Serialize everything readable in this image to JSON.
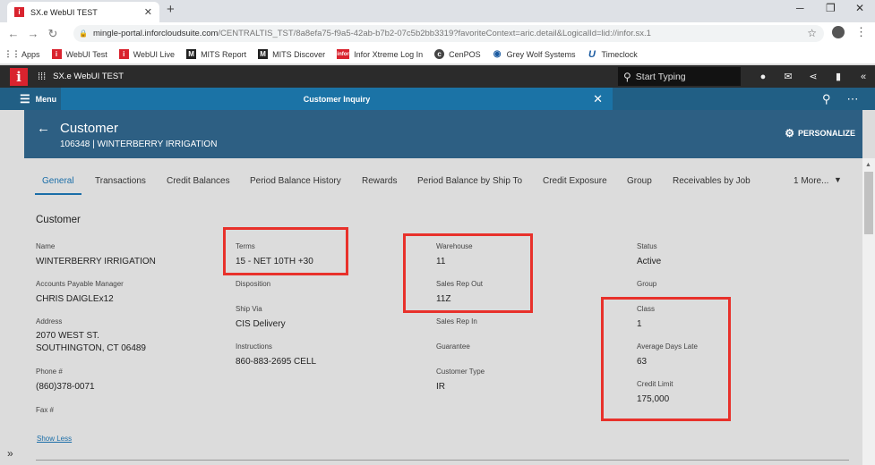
{
  "browser": {
    "tab_title": "SX.e WebUI TEST",
    "tab_favicon": "i",
    "new_tab": "+",
    "url_main": "mingle-portal.inforcloudsuite.com",
    "url_rest": "/CENTRALTIS_TST/8a8efa75-f9a5-42ab-b7b2-07c5b2bb3319?favoriteContext=aric.detail&LogicalId=lid://infor.sx.1",
    "bookmarks": [
      {
        "label": "Apps",
        "icon": "apps-grid-icon"
      },
      {
        "label": "WebUI Test",
        "icon": "infor-icon"
      },
      {
        "label": "WebUI Live",
        "icon": "infor-icon"
      },
      {
        "label": "MITS Report",
        "icon": "mits-icon"
      },
      {
        "label": "MITS Discover",
        "icon": "mits-icon"
      },
      {
        "label": "Infor Xtreme Log In",
        "icon": "infor-xtreme-icon"
      },
      {
        "label": "CenPOS",
        "icon": "cenpos-icon"
      },
      {
        "label": "Grey Wolf Systems",
        "icon": "greywolf-icon"
      },
      {
        "label": "Timeclock",
        "icon": "timeclock-icon"
      }
    ]
  },
  "appbar": {
    "title": "SX.e WebUI TEST",
    "search_placeholder": "Start Typing"
  },
  "navbar": {
    "menu_label": "Menu",
    "active_tab": "Customer Inquiry"
  },
  "header": {
    "title": "Customer",
    "subtitle": "106348 | WINTERBERRY IRRIGATION",
    "personalize": "PERSONALIZE"
  },
  "tabs": [
    "General",
    "Transactions",
    "Credit Balances",
    "Period Balance History",
    "Rewards",
    "Period Balance by Ship To",
    "Credit Exposure",
    "Group",
    "Receivables by Job",
    "1 More..."
  ],
  "section_title": "Customer",
  "fields": {
    "name_label": "Name",
    "name_value": "WINTERBERRY IRRIGATION",
    "ap_manager_label": "Accounts Payable Manager",
    "ap_manager_value": "CHRIS DAIGLEx12",
    "address_label": "Address",
    "address_line1": "2070 WEST ST.",
    "address_line2": "SOUTHINGTON, CT 06489",
    "phone_label": "Phone #",
    "phone_value": "(860)378-0071",
    "fax_label": "Fax #",
    "terms_label": "Terms",
    "terms_value": "15 - NET 10TH +30",
    "disposition_label": "Disposition",
    "shipvia_label": "Ship Via",
    "shipvia_value": "CIS Delivery",
    "instructions_label": "Instructions",
    "instructions_value": "860-883-2695 CELL",
    "warehouse_label": "Warehouse",
    "warehouse_value": "11",
    "salesrep_out_label": "Sales Rep Out",
    "salesrep_out_value": "11Z",
    "salesrep_in_label": "Sales Rep In",
    "guarantee_label": "Guarantee",
    "customer_type_label": "Customer Type",
    "customer_type_value": "IR",
    "status_label": "Status",
    "status_value": "Active",
    "group_label": "Group",
    "class_label": "Class",
    "class_value": "1",
    "avg_days_late_label": "Average Days Late",
    "avg_days_late_value": "63",
    "credit_limit_label": "Credit Limit",
    "credit_limit_value": "175,000"
  },
  "show_less": "Show Less",
  "colors": {
    "header_bg": "#2d5f83",
    "navbar_bg": "#215f85",
    "active_tab_bg": "#1b73a6",
    "highlight_box": "#e8312b",
    "brand_red": "#d9232e"
  }
}
